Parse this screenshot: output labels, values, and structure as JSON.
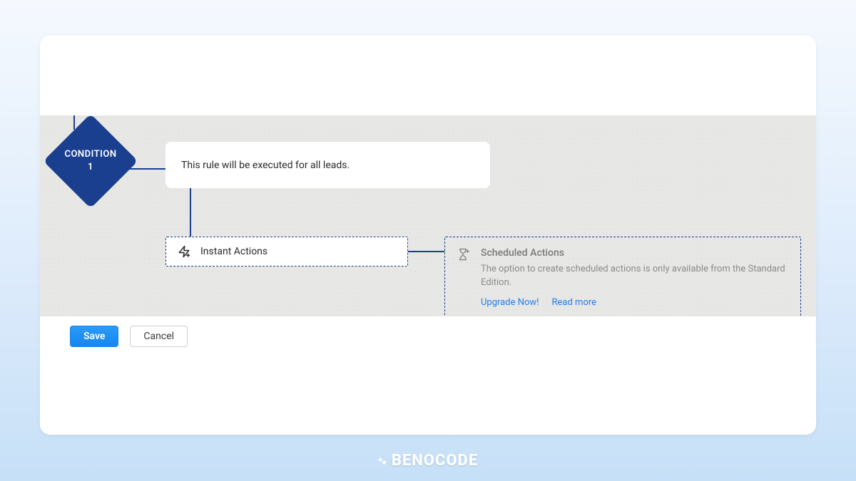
{
  "condition": {
    "label": "CONDITION",
    "number": "1"
  },
  "rule_description": "This rule will be executed for all leads.",
  "instant_actions": {
    "label": "Instant Actions"
  },
  "scheduled_actions": {
    "title": "Scheduled Actions",
    "description": "The option to create scheduled actions is only available from the Standard Edition.",
    "upgrade_link": "Upgrade Now!",
    "readmore_link": "Read more"
  },
  "footer": {
    "save": "Save",
    "cancel": "Cancel"
  },
  "brand": "BENOCODE"
}
